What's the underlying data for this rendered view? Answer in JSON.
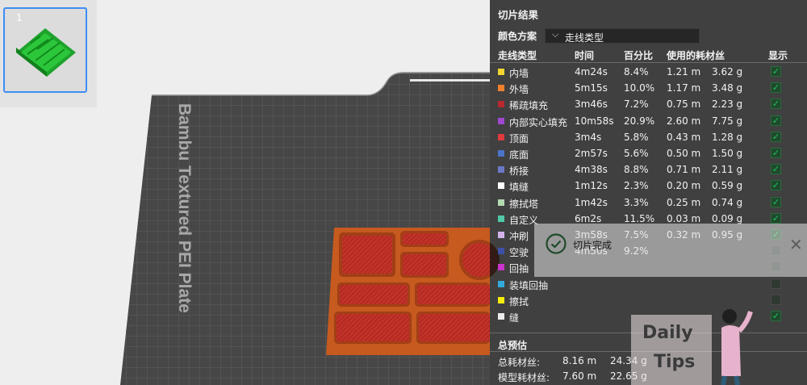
{
  "plate": {
    "number": "1",
    "plate_label": "Bambu Textured PEI Plate"
  },
  "results": {
    "title": "切片结果",
    "color_scheme_label": "颜色方案",
    "color_scheme_value": "走线类型",
    "headers": {
      "type": "走线类型",
      "time": "时间",
      "percent": "百分比",
      "filament": "使用的耗材丝",
      "show": "显示"
    },
    "rows": [
      {
        "color": "#f2d531",
        "label": "内墙",
        "time": "4m24s",
        "percent": "8.4%",
        "length": "1.21 m",
        "weight": "3.62 g",
        "shown": true
      },
      {
        "color": "#f07f2e",
        "label": "外墙",
        "time": "5m15s",
        "percent": "10.0%",
        "length": "1.17 m",
        "weight": "3.48 g",
        "shown": true
      },
      {
        "color": "#b8282e",
        "label": "稀疏填充",
        "time": "3m46s",
        "percent": "7.2%",
        "length": "0.75 m",
        "weight": "2.23 g",
        "shown": true
      },
      {
        "color": "#a048d1",
        "label": "内部实心填充",
        "time": "10m58s",
        "percent": "20.9%",
        "length": "2.60 m",
        "weight": "7.75 g",
        "shown": true
      },
      {
        "color": "#e0393e",
        "label": "顶面",
        "time": "3m4s",
        "percent": "5.8%",
        "length": "0.43 m",
        "weight": "1.28 g",
        "shown": true
      },
      {
        "color": "#4b73c8",
        "label": "底面",
        "time": "2m57s",
        "percent": "5.6%",
        "length": "0.50 m",
        "weight": "1.50 g",
        "shown": true
      },
      {
        "color": "#6a78c6",
        "label": "桥接",
        "time": "4m38s",
        "percent": "8.8%",
        "length": "0.71 m",
        "weight": "2.11 g",
        "shown": true
      },
      {
        "color": "#ffffff",
        "label": "填缝",
        "time": "1m12s",
        "percent": "2.3%",
        "length": "0.20 m",
        "weight": "0.59 g",
        "shown": true
      },
      {
        "color": "#b3d9b0",
        "label": "擦拭塔",
        "time": "1m42s",
        "percent": "3.3%",
        "length": "0.25 m",
        "weight": "0.74 g",
        "shown": true
      },
      {
        "color": "#4fc9a6",
        "label": "自定义",
        "time": "6m2s",
        "percent": "11.5%",
        "length": "0.03 m",
        "weight": "0.09 g",
        "shown": true
      },
      {
        "color": "#d3b2e9",
        "label": "冲刷",
        "time": "3m58s",
        "percent": "7.5%",
        "length": "0.32 m",
        "weight": "0.95 g",
        "shown": true
      },
      {
        "color": "#3d4fa8",
        "label": "空驶",
        "time": "4m50s",
        "percent": "9.2%",
        "length": "",
        "weight": "",
        "shown": false
      },
      {
        "color": "#cc33cc",
        "label": "回抽",
        "time": "",
        "percent": "",
        "length": "",
        "weight": "",
        "shown": false
      },
      {
        "color": "#33aadd",
        "label": "装填回抽",
        "time": "",
        "percent": "",
        "length": "",
        "weight": "",
        "shown": false
      },
      {
        "color": "#f5ee0a",
        "label": "擦拭",
        "time": "",
        "percent": "",
        "length": "",
        "weight": "",
        "shown": false
      },
      {
        "color": "#ececec",
        "label": "缝",
        "time": "",
        "percent": "",
        "length": "",
        "weight": "",
        "shown": true
      }
    ],
    "summary": {
      "title": "总预估",
      "total_label": "总耗材丝:",
      "total_length": "8.16 m",
      "total_weight": "24.34 g",
      "model_label": "模型耗材丝:",
      "model_length": "7.60 m",
      "model_weight": "22.65 g"
    }
  },
  "toast": {
    "message": "切片完成",
    "icon": "check-circle-icon",
    "close_icon": "close-icon"
  },
  "tips": {
    "line1": "Daily",
    "line2": "Tips"
  },
  "colors": {
    "accent": "#3f8df3",
    "check": "#21c35c",
    "model": "#c9541f",
    "model_infill": "#b8282e"
  }
}
